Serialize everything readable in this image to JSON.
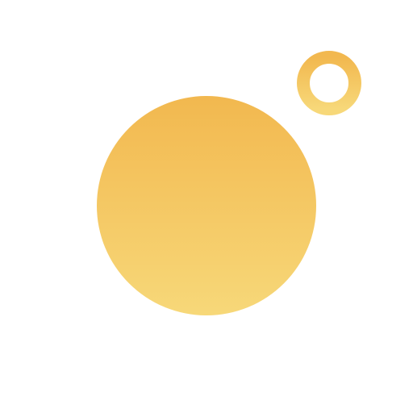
{
  "colors": {
    "background": "#ffffff",
    "gradient_top": "#f2b84f",
    "gradient_bottom": "#f7d879"
  },
  "icons": {
    "main": "large-circle-icon",
    "accent": "small-ring-icon"
  }
}
